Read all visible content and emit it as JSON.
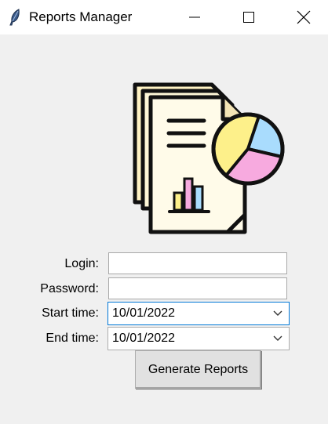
{
  "window": {
    "title": "Reports Manager",
    "app_icon": "feather-icon",
    "controls": [
      "minimize-icon",
      "maximize-icon",
      "close-icon"
    ]
  },
  "illustration": "report-documents-pie-chart-icon",
  "form": {
    "login_label": "Login:",
    "login_value": "",
    "password_label": "Password:",
    "password_value": "",
    "start_label": "Start time:",
    "start_value": "10/01/2022",
    "end_label": "End time:",
    "end_value": "10/01/2022"
  },
  "actions": {
    "generate_label": "Generate Reports"
  },
  "colors": {
    "focus_border": "#0078d7",
    "pie_yellow": "#fdf08a",
    "pie_blue": "#a9dcfd",
    "pie_pink": "#f7aadf"
  }
}
